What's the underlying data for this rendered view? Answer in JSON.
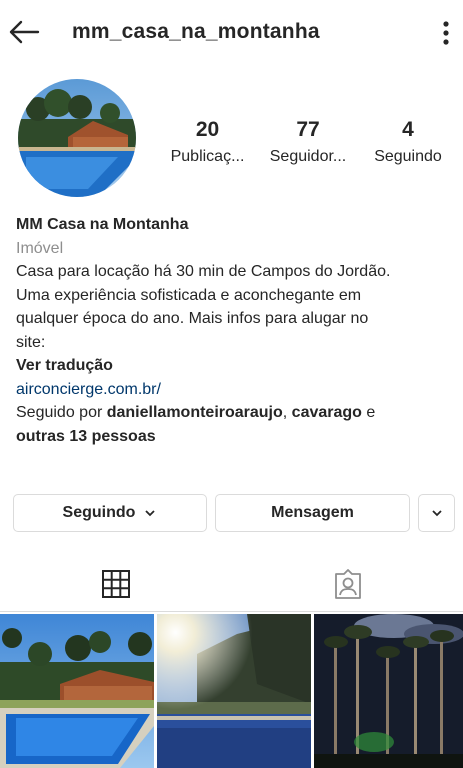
{
  "header": {
    "username": "mm_casa_na_montanha"
  },
  "stats": [
    {
      "value": "20",
      "label": "Publicaç..."
    },
    {
      "value": "77",
      "label": "Seguidor..."
    },
    {
      "value": "4",
      "label": "Seguindo"
    }
  ],
  "bio": {
    "name": "MM Casa na Montanha",
    "category": "Imóvel",
    "lines": [
      "Casa para locação há 30 min de Campos do Jordão.",
      "Uma experiência sofisticada e aconchegante em",
      "qualquer época do ano. Mais infos para alugar no",
      "site:"
    ],
    "translate": "Ver tradução",
    "link": "airconcierge.com.br/",
    "followed_prefix": "Seguido por ",
    "followed_user1": "daniellamonteiroaraujo",
    "followed_sep": ", ",
    "followed_user2": "cavarago",
    "followed_and": " e",
    "followed_others": "outras 13 pessoas"
  },
  "actions": {
    "following": "Seguindo",
    "message": "Mensagem"
  },
  "colors": {
    "link": "#00376b",
    "muted": "#8e8e8e",
    "border": "#dbdbdb",
    "text": "#262626"
  }
}
